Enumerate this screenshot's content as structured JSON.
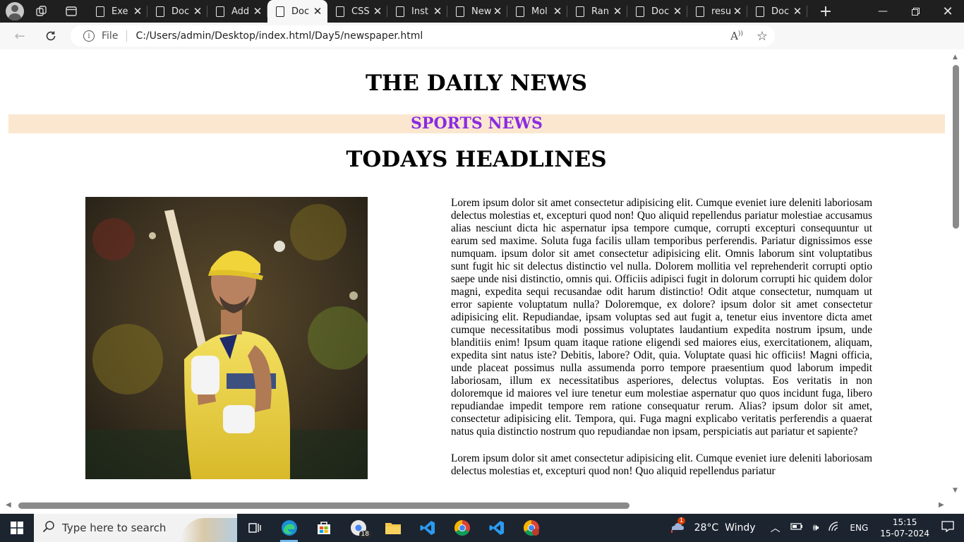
{
  "browser": {
    "tabs": [
      {
        "title": "Exe"
      },
      {
        "title": "Doc"
      },
      {
        "title": "Add"
      },
      {
        "title": "Doc",
        "active": true
      },
      {
        "title": "CSS"
      },
      {
        "title": "Inst"
      },
      {
        "title": "New"
      },
      {
        "title": "Mol"
      },
      {
        "title": "Ran"
      },
      {
        "title": "Doc"
      },
      {
        "title": "resu"
      },
      {
        "title": "Doc"
      }
    ],
    "file_label": "File",
    "url": "C:/Users/admin/Desktop/index.html/Day5/newspaper.html"
  },
  "page": {
    "masthead": "THE DAILY NEWS",
    "section": "SPORTS NEWS",
    "headline": "TODAYS HEADLINES",
    "section_color": "#8a2be2",
    "section_bg": "#fbe7d0",
    "paragraphs": [
      "Lorem ipsum dolor sit amet consectetur adipisicing elit. Cumque eveniet iure deleniti laboriosam delectus molestias et, excepturi quod non! Quo aliquid repellendus pariatur molestiae accusamus alias nesciunt dicta hic aspernatur ipsa tempore cumque, corrupti excepturi consequuntur ut earum sed maxime. Soluta fuga facilis ullam temporibus perferendis. Pariatur dignissimos esse numquam. ipsum dolor sit amet consectetur adipisicing elit. Omnis laborum sint voluptatibus sunt fugit hic sit delectus distinctio vel nulla. Dolorem mollitia vel reprehenderit corrupti optio saepe unde nisi distinctio, omnis qui. Officiis adipisci fugit in dolorum corrupti hic quidem dolor magni, expedita sequi recusandae odit harum distinctio! Odit atque consectetur, numquam ut error sapiente voluptatum nulla? Doloremque, ex dolore? ipsum dolor sit amet consectetur adipisicing elit. Repudiandae, ipsam voluptas sed aut fugit a, tenetur eius inventore dicta amet cumque necessitatibus modi possimus voluptates laudantium expedita nostrum ipsum, unde blanditiis enim! Ipsum quam itaque ratione eligendi sed maiores eius, exercitationem, aliquam, expedita sint natus iste? Debitis, labore? Odit, quia. Voluptate quasi hic officiis! Magni officia, unde placeat possimus nulla assumenda porro tempore praesentium quod laborum impedit laboriosam, illum ex necessitatibus asperiores, delectus voluptas. Eos veritatis in non doloremque id maiores vel iure tenetur eum molestiae aspernatur quo quos incidunt fuga, libero repudiandae impedit tempore rem ratione consequatur rerum. Alias? ipsum dolor sit amet, consectetur adipisicing elit. Tempora, qui. Fuga magni explicabo veritatis perferendis a quaerat natus quia distinctio nostrum quo repudiandae non ipsam, perspiciatis aut pariatur et sapiente?",
      "Lorem ipsum dolor sit amet consectetur adipisicing elit. Cumque eveniet iure deleniti laboriosam delectus molestias et, excepturi quod non! Quo aliquid repellendus pariatur"
    ]
  },
  "taskbar": {
    "search_placeholder": "Type here to search",
    "chrome_badge": "18",
    "weather": "28°C  Windy",
    "weather_badge": "1",
    "language": "ENG",
    "time": "15:15",
    "date": "15-07-2024"
  }
}
